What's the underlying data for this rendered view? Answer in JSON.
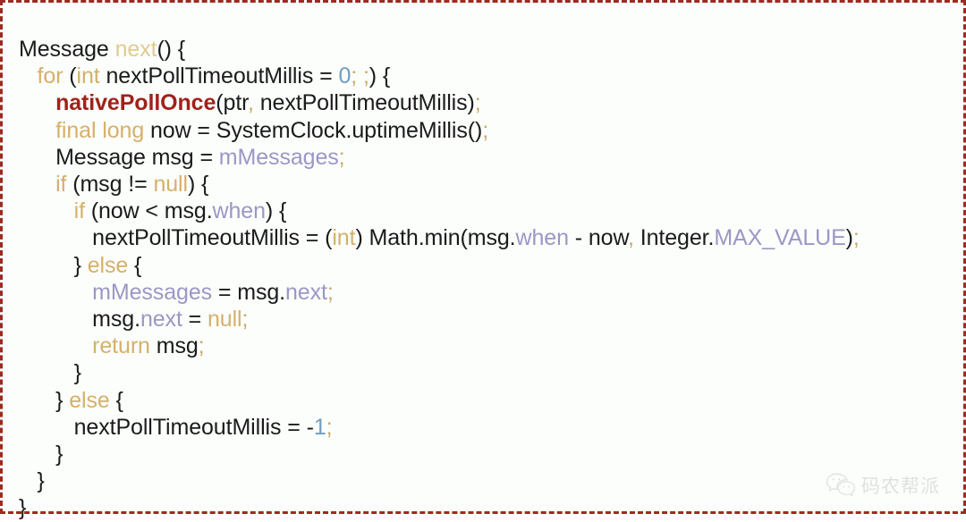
{
  "snippet": {
    "language": "java",
    "border_color": "#9d2a20",
    "background_color": "#fbfefb",
    "colors": {
      "plain": "#1b1b1b",
      "keyword": "#d6b06a",
      "method": "#e0cb92",
      "native_method": "#a0221a",
      "field": "#9d96c6",
      "number": "#6f9dc0",
      "punctuation": "#c8a96a"
    },
    "lines": [
      {
        "indent": 0,
        "tokens": [
          {
            "text": "Message ",
            "kind": "plain"
          },
          {
            "text": "next",
            "kind": "method"
          },
          {
            "text": "() {",
            "kind": "plain"
          }
        ]
      },
      {
        "indent": 1,
        "tokens": [
          {
            "text": "for ",
            "kind": "keyword"
          },
          {
            "text": "(",
            "kind": "plain"
          },
          {
            "text": "int",
            "kind": "keyword"
          },
          {
            "text": " nextPollTimeoutMillis = ",
            "kind": "plain"
          },
          {
            "text": "0",
            "kind": "number"
          },
          {
            "text": "; ;",
            "kind": "punctuation"
          },
          {
            "text": ") {",
            "kind": "plain"
          }
        ]
      },
      {
        "indent": 2,
        "tokens": [
          {
            "text": "nativePollOnce",
            "kind": "native_method"
          },
          {
            "text": "(ptr",
            "kind": "plain"
          },
          {
            "text": ",",
            "kind": "punctuation"
          },
          {
            "text": " nextPollTimeoutMillis)",
            "kind": "plain"
          },
          {
            "text": ";",
            "kind": "punctuation"
          }
        ]
      },
      {
        "indent": 2,
        "tokens": [
          {
            "text": "final long",
            "kind": "keyword"
          },
          {
            "text": " now = SystemClock.uptimeMillis()",
            "kind": "plain"
          },
          {
            "text": ";",
            "kind": "punctuation"
          }
        ]
      },
      {
        "indent": 2,
        "tokens": [
          {
            "text": "Message msg = ",
            "kind": "plain"
          },
          {
            "text": "mMessages",
            "kind": "field"
          },
          {
            "text": ";",
            "kind": "punctuation"
          }
        ]
      },
      {
        "indent": 2,
        "tokens": [
          {
            "text": "if",
            "kind": "keyword"
          },
          {
            "text": " (msg != ",
            "kind": "plain"
          },
          {
            "text": "null",
            "kind": "keyword"
          },
          {
            "text": ") {",
            "kind": "plain"
          }
        ]
      },
      {
        "indent": 3,
        "tokens": [
          {
            "text": "if",
            "kind": "keyword"
          },
          {
            "text": " (now < msg.",
            "kind": "plain"
          },
          {
            "text": "when",
            "kind": "field"
          },
          {
            "text": ") {",
            "kind": "plain"
          }
        ]
      },
      {
        "indent": 4,
        "tokens": [
          {
            "text": "nextPollTimeoutMillis = (",
            "kind": "plain"
          },
          {
            "text": "int",
            "kind": "keyword"
          },
          {
            "text": ") Math.min(msg.",
            "kind": "plain"
          },
          {
            "text": "when",
            "kind": "field"
          },
          {
            "text": " - now",
            "kind": "plain"
          },
          {
            "text": ",",
            "kind": "punctuation"
          },
          {
            "text": " Integer.",
            "kind": "plain"
          },
          {
            "text": "MAX_VALUE",
            "kind": "field"
          },
          {
            "text": ")",
            "kind": "plain"
          },
          {
            "text": ";",
            "kind": "punctuation"
          }
        ]
      },
      {
        "indent": 3,
        "tokens": [
          {
            "text": "} ",
            "kind": "plain"
          },
          {
            "text": "else",
            "kind": "keyword"
          },
          {
            "text": " {",
            "kind": "plain"
          }
        ]
      },
      {
        "indent": 4,
        "tokens": [
          {
            "text": "mMessages",
            "kind": "field"
          },
          {
            "text": " = msg.",
            "kind": "plain"
          },
          {
            "text": "next",
            "kind": "field"
          },
          {
            "text": ";",
            "kind": "punctuation"
          }
        ]
      },
      {
        "indent": 4,
        "tokens": [
          {
            "text": "msg.",
            "kind": "plain"
          },
          {
            "text": "next",
            "kind": "field"
          },
          {
            "text": " = ",
            "kind": "plain"
          },
          {
            "text": "null",
            "kind": "keyword"
          },
          {
            "text": ";",
            "kind": "punctuation"
          }
        ]
      },
      {
        "indent": 4,
        "tokens": [
          {
            "text": "return",
            "kind": "keyword"
          },
          {
            "text": " msg",
            "kind": "plain"
          },
          {
            "text": ";",
            "kind": "punctuation"
          }
        ]
      },
      {
        "indent": 3,
        "tokens": [
          {
            "text": "}",
            "kind": "plain"
          }
        ]
      },
      {
        "indent": 2,
        "tokens": [
          {
            "text": "} ",
            "kind": "plain"
          },
          {
            "text": "else",
            "kind": "keyword"
          },
          {
            "text": " {",
            "kind": "plain"
          }
        ]
      },
      {
        "indent": 3,
        "tokens": [
          {
            "text": "nextPollTimeoutMillis = -",
            "kind": "plain"
          },
          {
            "text": "1",
            "kind": "number"
          },
          {
            "text": ";",
            "kind": "punctuation"
          }
        ]
      },
      {
        "indent": 2,
        "tokens": [
          {
            "text": "}",
            "kind": "plain"
          }
        ]
      },
      {
        "indent": 1,
        "tokens": [
          {
            "text": "}",
            "kind": "plain"
          }
        ]
      },
      {
        "indent": 0,
        "tokens": [
          {
            "text": "}",
            "kind": "plain"
          }
        ]
      }
    ]
  },
  "watermark": {
    "icon": "wechat-logo-icon",
    "text": "码农帮派",
    "color": "#b9b9b9"
  }
}
